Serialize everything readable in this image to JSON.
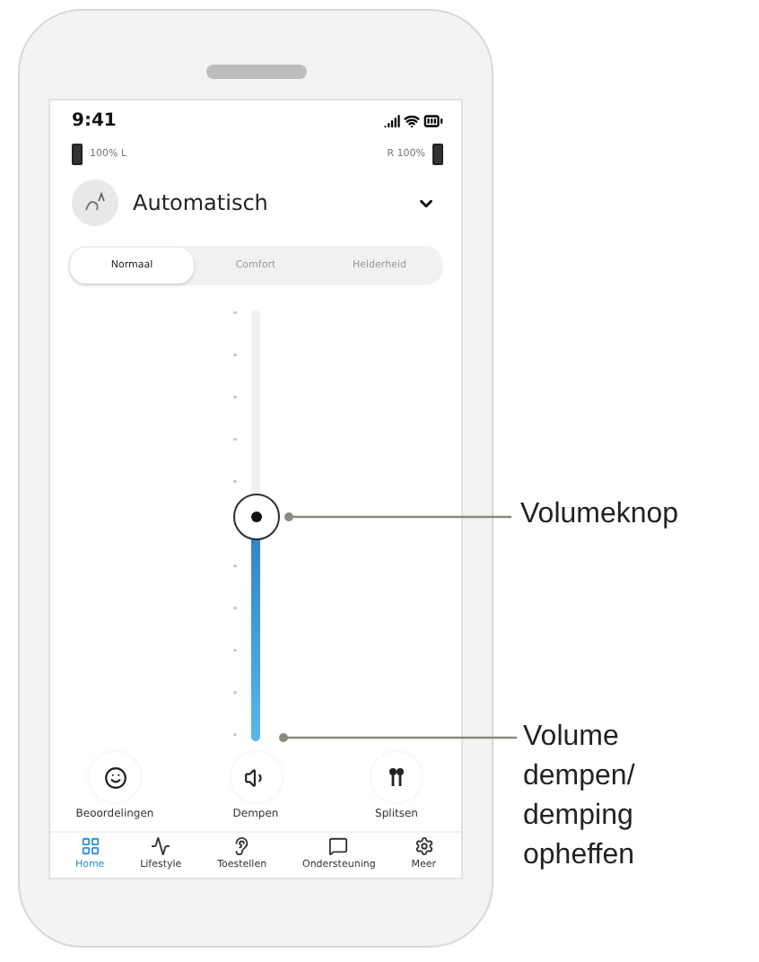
{
  "status_bar": {
    "time": "9:41"
  },
  "batteries": {
    "left": "100% L",
    "right": "R 100%"
  },
  "program": {
    "name": "Automatisch"
  },
  "tabs": [
    {
      "label": "Normaal",
      "selected": true
    },
    {
      "label": "Comfort",
      "selected": false
    },
    {
      "label": "Helderheid",
      "selected": false
    }
  ],
  "volume": {
    "level": 0.52
  },
  "actions": [
    {
      "label": "Beoordelingen"
    },
    {
      "label": "Dempen"
    },
    {
      "label": "Splitsen"
    }
  ],
  "nav": [
    {
      "label": "Home",
      "selected": true
    },
    {
      "label": "Lifestyle",
      "selected": false
    },
    {
      "label": "Toestellen",
      "selected": false
    },
    {
      "label": "Ondersteuning",
      "selected": false
    },
    {
      "label": "Meer",
      "selected": false
    }
  ],
  "annotations": {
    "volume_knob": "Volumeknop",
    "mute": "Volume dempen/ demping opheffen"
  }
}
